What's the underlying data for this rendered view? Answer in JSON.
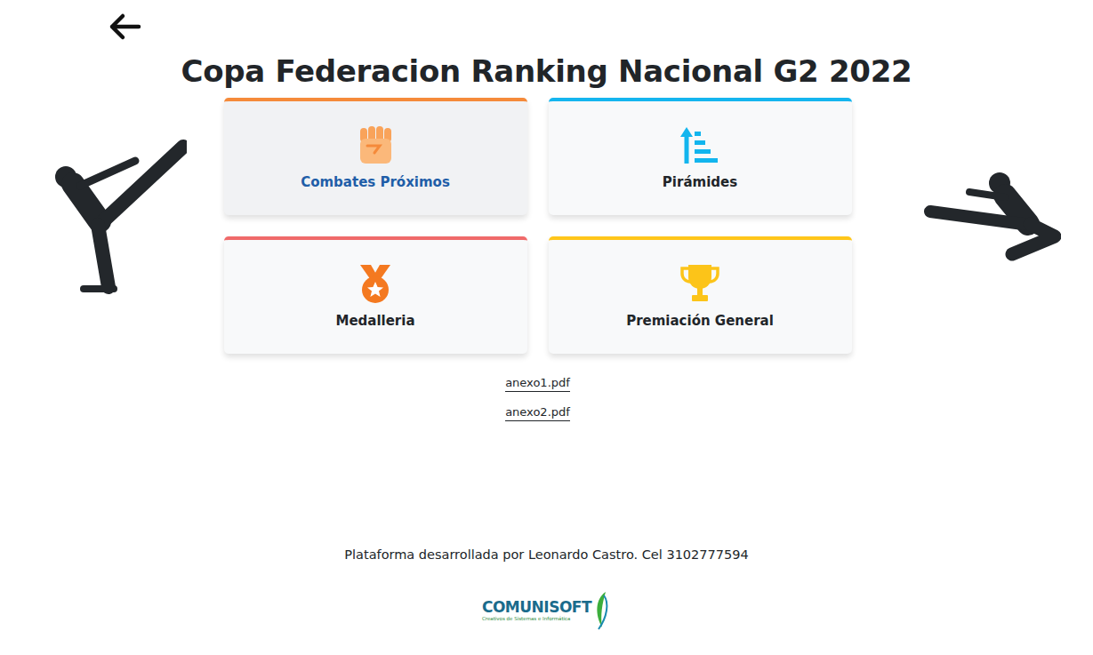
{
  "title": "Copa Federacion Ranking Nacional G2 2022",
  "tiles": [
    {
      "label": "Combates Próximos",
      "selected": true,
      "color": "#f58a3a"
    },
    {
      "label": "Pirámides",
      "selected": false,
      "color": "#14b5ef"
    },
    {
      "label": "Medalleria",
      "selected": false,
      "color": "#f06a6a"
    },
    {
      "label": "Premiación General",
      "selected": false,
      "color": "#ffc61a"
    }
  ],
  "files": [
    "anexo1.pdf",
    "anexo2.pdf"
  ],
  "footer": {
    "credit": "Plataforma desarrollada por Leonardo Castro. Cel 3102777594",
    "logo": "COMUNISOFT",
    "logo_sub": "Creativos de Sistemas e Informática"
  }
}
